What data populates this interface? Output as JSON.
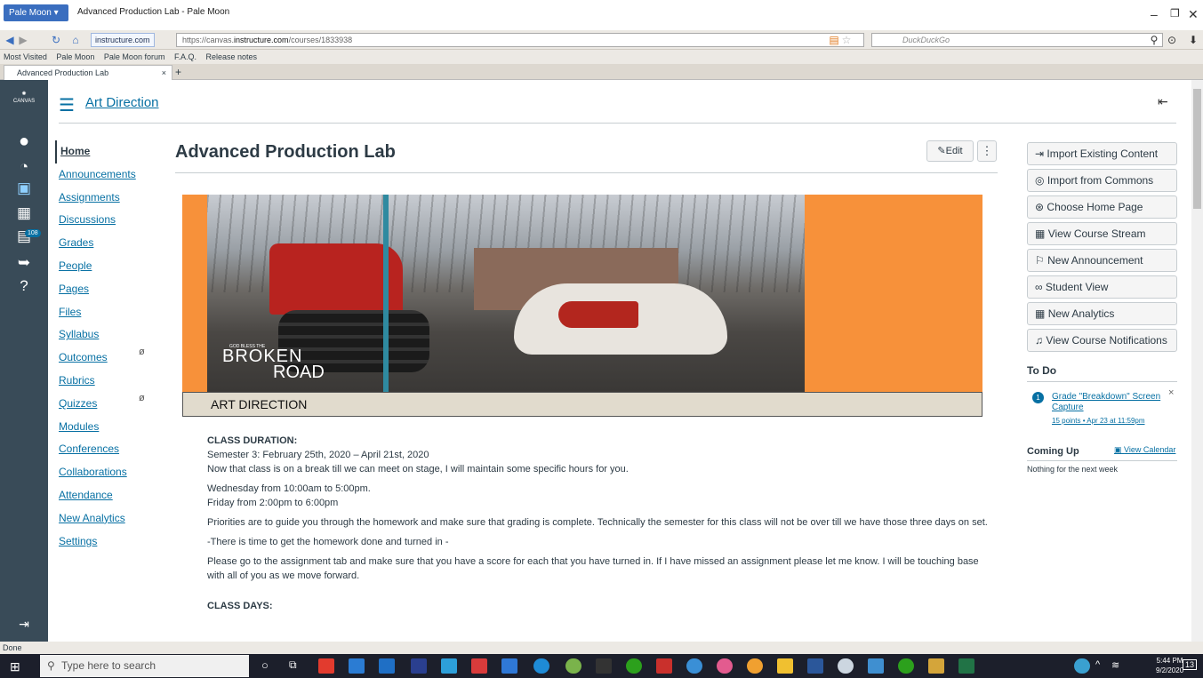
{
  "browser": {
    "app_button": "Pale Moon",
    "window_title": "Advanced Production Lab - Pale Moon",
    "site_identity": "instructure.com",
    "url_prefix": "https://canvas.",
    "url_domain": "instructure.com",
    "url_path": "/courses/1833938",
    "search_placeholder": "DuckDuckGo",
    "bookmarks": [
      "Most Visited",
      "Pale Moon",
      "Pale Moon forum",
      "F.A.Q.",
      "Release notes"
    ],
    "tab_title": "Advanced Production Lab",
    "status": "Done"
  },
  "global_nav": {
    "logo": "CANVAS",
    "badge_count": "108",
    "icons": [
      "account-icon",
      "dashboard-icon",
      "courses-icon",
      "calendar-icon",
      "inbox-icon",
      "commons-icon",
      "help-icon"
    ]
  },
  "breadcrumb": "Art Direction",
  "course_nav": [
    {
      "label": "Home",
      "active": true
    },
    {
      "label": "Announcements"
    },
    {
      "label": "Assignments"
    },
    {
      "label": "Discussions"
    },
    {
      "label": "Grades"
    },
    {
      "label": "People"
    },
    {
      "label": "Pages"
    },
    {
      "label": "Files"
    },
    {
      "label": "Syllabus"
    },
    {
      "label": "Outcomes",
      "hidden_icon": true
    },
    {
      "label": "Rubrics"
    },
    {
      "label": "Quizzes",
      "hidden_icon": true
    },
    {
      "label": "Modules"
    },
    {
      "label": "Conferences"
    },
    {
      "label": "Collaborations"
    },
    {
      "label": "Attendance"
    },
    {
      "label": "New Analytics"
    },
    {
      "label": "Settings"
    }
  ],
  "page_title": "Advanced Production Lab",
  "edit_label": "Edit",
  "more_label": "⋮",
  "banner": {
    "small_text": "GOD BLESS THE",
    "line1": "BROKEN",
    "line2": "ROAD",
    "bar_text": "ART DIRECTION"
  },
  "content": {
    "duration_heading": "CLASS DURATION:",
    "duration_line1": "Semester 3:  February 25th, 2020 – April 21st, 2020",
    "duration_line2": "Now that class is on a break till we can meet on stage, I will maintain some specific hours for you.",
    "hours1": "Wednesday from 10:00am to 5:00pm.",
    "hours2": "Friday from 2:00pm to 6:00pm",
    "priorities": "Priorities are to guide you through the homework and make sure that grading is complete. Technically the semester for this class will not be over till we have those three days on set.",
    "time_note": "-There is time to get the homework done and turned in -",
    "assignment_note": "Please go to the assignment tab and make sure that you have a score for each that you have turned in. If I have missed an assignment please let me know. I will be touching base with all of you as we move forward.",
    "days_heading": "CLASS DAYS:"
  },
  "sidebar": {
    "buttons": [
      {
        "icon": "import-icon",
        "glyph": "⇥",
        "label": "Import Existing Content"
      },
      {
        "icon": "commons-icon",
        "glyph": "◎",
        "label": "Import from Commons"
      },
      {
        "icon": "home-page-icon",
        "glyph": "⊛",
        "label": "Choose Home Page"
      },
      {
        "icon": "stream-icon",
        "glyph": "▦",
        "label": "View Course Stream"
      },
      {
        "icon": "announcement-icon",
        "glyph": "⚐",
        "label": "New Announcement"
      },
      {
        "icon": "student-view-icon",
        "glyph": "∞",
        "label": "Student View"
      },
      {
        "icon": "analytics-icon",
        "glyph": "▦",
        "label": "New Analytics"
      },
      {
        "icon": "bell-icon",
        "glyph": "♫",
        "label": "View Course Notifications"
      }
    ],
    "todo_heading": "To Do",
    "todo_count": "1",
    "todo_item": "Grade \"Breakdown\" Screen Capture",
    "todo_meta": "15 points • Apr 23 at 11:59pm",
    "coming_up": "Coming Up",
    "view_calendar": "View Calendar",
    "nothing": "Nothing for the next week"
  },
  "taskbar": {
    "search": "Type here to search",
    "time": "5:44 PM",
    "date": "9/2/2020",
    "notif": "13"
  }
}
